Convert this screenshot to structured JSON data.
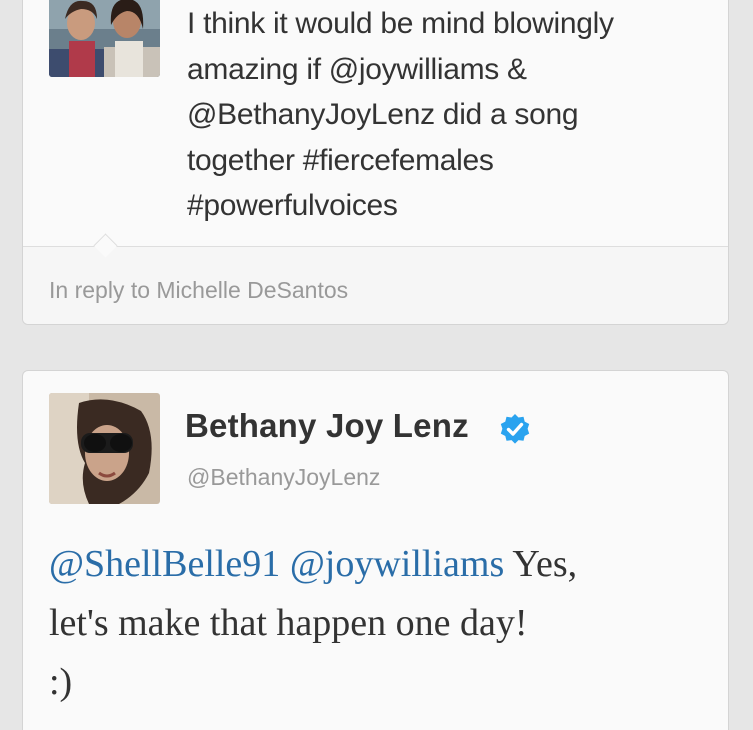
{
  "top_tweet": {
    "text_line1": "I think it would be mind blowingly",
    "text_line2": "amazing if @joywilliams &",
    "text_line3": "@BethanyJoyLenz did a song",
    "text_line4": "together #fiercefemales",
    "text_line5": "#powerfulvoices",
    "in_reply_to": "In reply to Michelle DeSantos"
  },
  "reply_tweet": {
    "display_name": "Bethany Joy Lenz",
    "handle": "@BethanyJoyLenz",
    "mention1": "@ShellBelle91",
    "mention2": "@joywilliams",
    "text_part1": "Yes,",
    "text_line2": "let's make that happen one day!",
    "text_line3": ":)"
  },
  "icons": {
    "verified": "verified-badge-icon"
  },
  "colors": {
    "mention": "#2a6da8",
    "verified": "#2aa3ef",
    "text": "#333333",
    "muted": "#999999",
    "card": "#fafafa",
    "background": "#e6e6e6"
  }
}
